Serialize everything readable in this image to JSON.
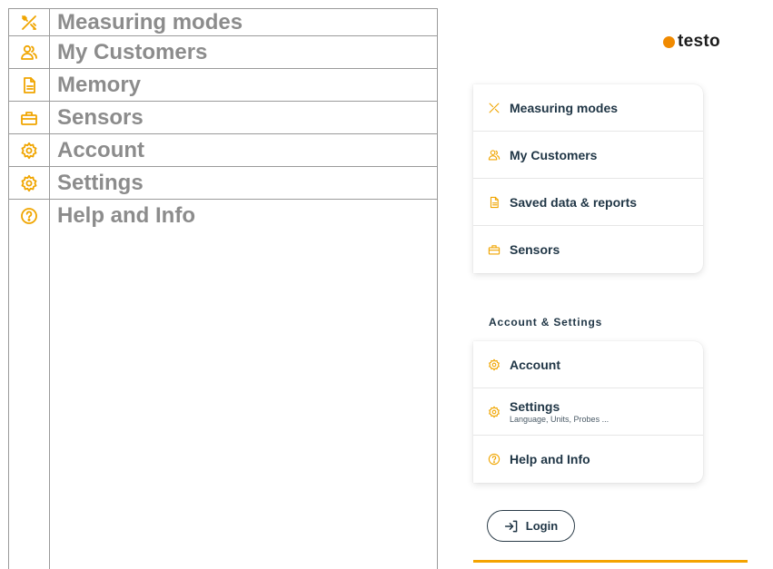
{
  "doc_table": {
    "rows": [
      {
        "icon": "tools-icon",
        "label": "Measuring modes"
      },
      {
        "icon": "customers-icon",
        "label": "My Customers"
      },
      {
        "icon": "document-icon",
        "label": "Memory"
      },
      {
        "icon": "toolbox-icon",
        "label": "Sensors"
      },
      {
        "icon": "gear-icon",
        "label": "Account"
      },
      {
        "icon": "gear-icon",
        "label": "Settings"
      },
      {
        "icon": "help-icon",
        "label": "Help and Info"
      }
    ]
  },
  "app": {
    "logo_text": "testo",
    "brand_color": "#f08a00",
    "main_menu": [
      {
        "icon": "tools-icon",
        "label": "Measuring modes"
      },
      {
        "icon": "customers-icon",
        "label": "My Customers"
      },
      {
        "icon": "document-icon",
        "label": "Saved data & reports"
      },
      {
        "icon": "toolbox-icon",
        "label": "Sensors"
      }
    ],
    "section_title": "Account & Settings",
    "settings_menu": [
      {
        "icon": "gear-icon",
        "label": "Account",
        "sub": ""
      },
      {
        "icon": "gear-icon",
        "label": "Settings",
        "sub": "Language, Units, Probes ..."
      },
      {
        "icon": "help-icon",
        "label": "Help and Info",
        "sub": ""
      }
    ],
    "login_label": "Login",
    "accent_color": "#f4a300"
  }
}
